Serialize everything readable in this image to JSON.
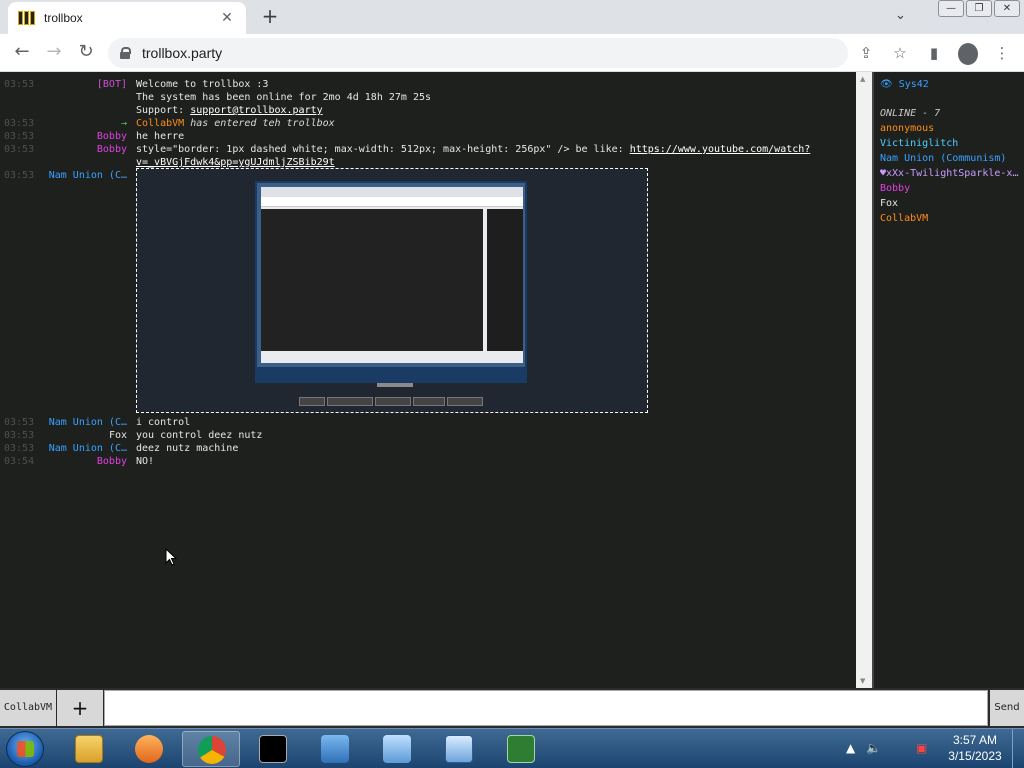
{
  "browser": {
    "tab_title": "trollbox",
    "tab_close": "✕",
    "new_tab": "+",
    "tab_menu": "⌄",
    "window_buttons": [
      "—",
      "❐",
      "✕"
    ],
    "url": "trollbox.party"
  },
  "chat": {
    "messages": [
      {
        "time": "03:53",
        "nick": "[BOT]",
        "nick_color": "#d050d0",
        "text": "Welcome to trollbox :3"
      },
      {
        "time": "",
        "nick": "",
        "nick_color": "",
        "text": "The system has been online for 2mo 4d 18h 27m 25s"
      },
      {
        "time": "",
        "nick": "",
        "nick_color": "",
        "text_prefix": "Support: ",
        "text_link": "support@trollbox.party"
      },
      {
        "time": "03:53",
        "nick": "→",
        "nick_color": "#4ec94e",
        "text_nick": "CollabVM",
        "text_nick_color": "#ff8c1a",
        "text_italic": "has entered teh trollbox"
      },
      {
        "time": "03:53",
        "nick": "Bobby",
        "nick_color": "#e040e0",
        "text": "he herre"
      },
      {
        "time": "03:53",
        "nick": "Bobby",
        "nick_color": "#e040e0",
        "text_prefix": "style=\"border: 1px dashed white; max-width: 512px; max-height: 256px\"   /> be like: ",
        "text_link": "https://www.youtube.com/watch?"
      },
      {
        "time": "",
        "nick": "",
        "nick_color": "",
        "text_link": "v=_vBVGjFdwk4&pp=ygUJdmljZSBib29t"
      },
      {
        "time": "03:53",
        "nick": "Nam Union (C…",
        "nick_color": "#39a0ff",
        "text": ""
      },
      {
        "time": "03:53",
        "nick": "Nam Union (C…",
        "nick_color": "#39a0ff",
        "text": "i control"
      },
      {
        "time": "03:53",
        "nick": "Fox",
        "nick_color": "#e6e6e6",
        "text": "you control deez nutz"
      },
      {
        "time": "03:53",
        "nick": "Nam Union (C…",
        "nick_color": "#39a0ff",
        "text": "deez nutz machine"
      },
      {
        "time": "03:54",
        "nick": "Bobby",
        "nick_color": "#e040e0",
        "text": "NO!"
      }
    ]
  },
  "sidebar": {
    "me": "👁 Sys42",
    "online_label": "ONLINE - 7",
    "users": [
      {
        "name": "anonymous",
        "color": "#ff8c1a"
      },
      {
        "name": "Victiniglitch",
        "color": "#4fd0ff"
      },
      {
        "name": "Nam Union (Communism)",
        "color": "#39a0ff"
      },
      {
        "name": "♥xXx-TwilightSparkle-xXx",
        "color": "#c89cff"
      },
      {
        "name": "Bobby",
        "color": "#e040e0"
      },
      {
        "name": "Fox",
        "color": "#e6e6e6"
      },
      {
        "name": "CollabVM",
        "color": "#ff8c1a"
      }
    ]
  },
  "input": {
    "nick_button": "CollabVM",
    "plus_button": "+",
    "placeholder": "",
    "send_button": "Send"
  },
  "taskbar": {
    "time": "3:57 AM",
    "date": "3/15/2023"
  }
}
